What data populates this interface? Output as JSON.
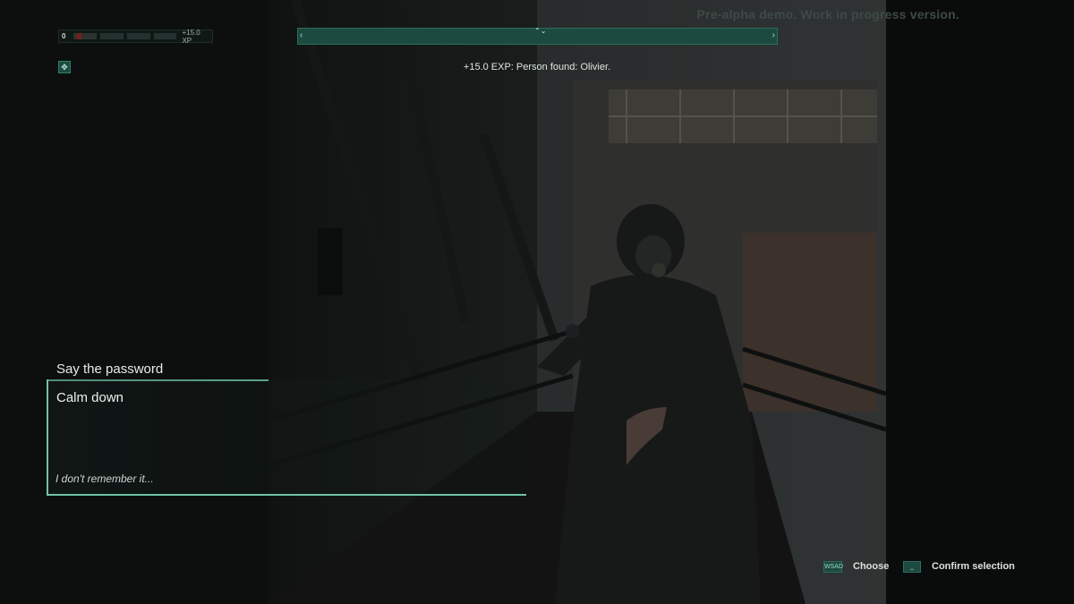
{
  "watermark": "Pre-alpha demo. Work in progress version.",
  "xp": {
    "level": "0",
    "gain": "+15.0 XP"
  },
  "compass": {
    "left": "‹",
    "right": "›",
    "mid": "⌃⌄"
  },
  "notification": "+15.0 EXP: Person found: Olivier.",
  "dialogue": {
    "prompt": "Say the password",
    "options": [
      "Calm down",
      "I don't remember it..."
    ]
  },
  "hints": [
    {
      "key": "WSAD",
      "label": "Choose"
    },
    {
      "key": "⎵",
      "label": "Confirm selection"
    }
  ]
}
